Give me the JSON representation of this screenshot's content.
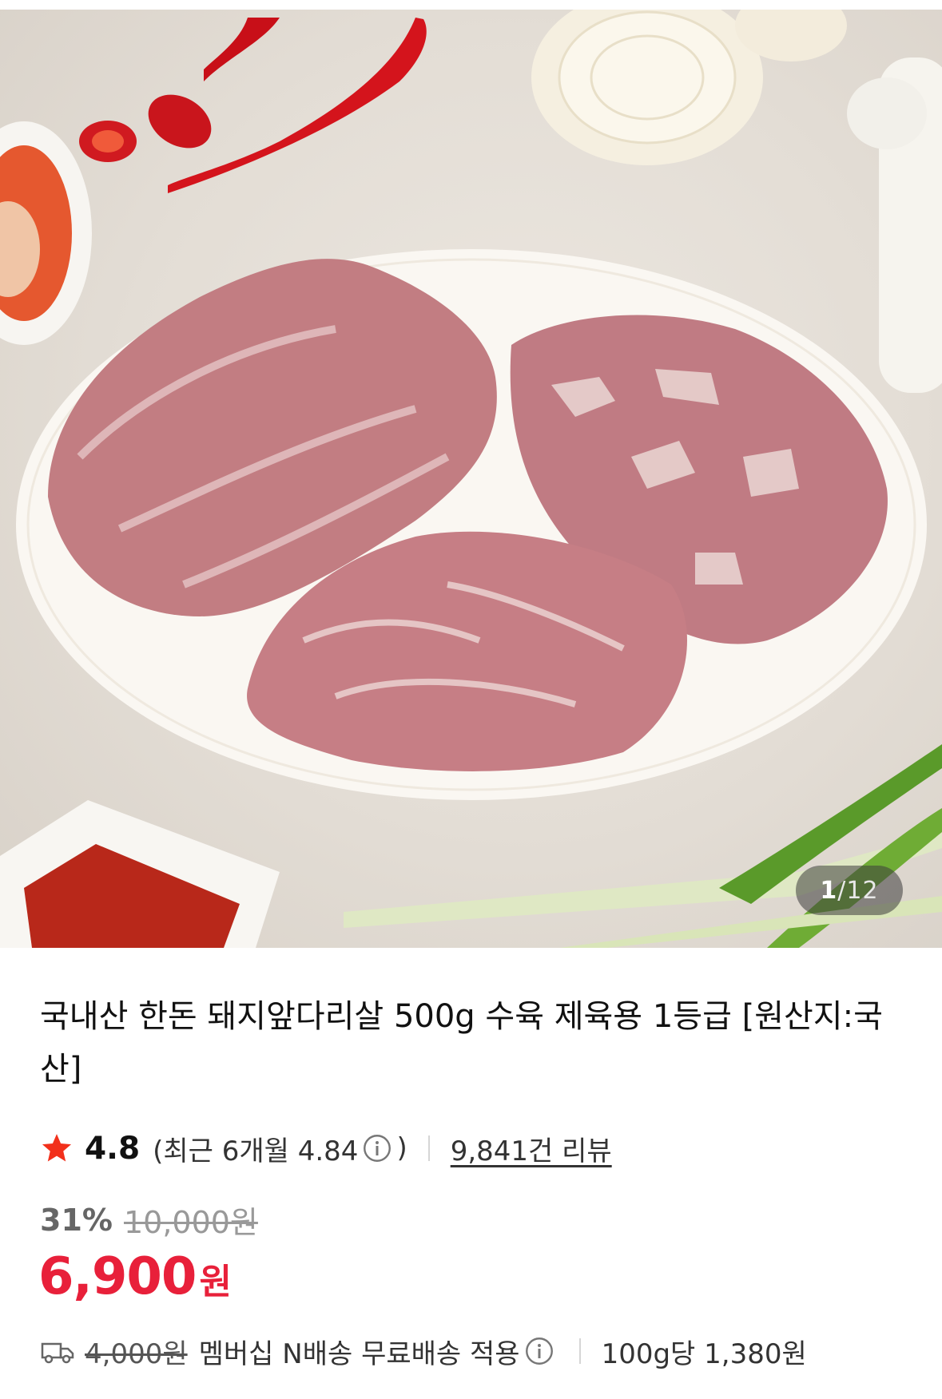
{
  "gallery": {
    "current": "1",
    "separator": "/",
    "total": "12"
  },
  "product": {
    "title": "국내산 한돈 돼지앞다리살 500g 수육 제육용 1등급 [원산지:국산]"
  },
  "rating": {
    "score": "4.8",
    "recent_prefix": "(최근 6개월 4.84",
    "recent_suffix": ")",
    "review_count": "9,841건 리뷰"
  },
  "price": {
    "discount_rate": "31%",
    "original": "10,000원",
    "sale": "6,900",
    "currency": "원"
  },
  "shipping": {
    "original_fee": "4,000원",
    "label": "멤버십 N배송 무료배송 적용",
    "unit_price": "100g당 1,380원"
  },
  "colors": {
    "accent": "#e8203a",
    "star": "#f2301b",
    "text": "#111111",
    "muted": "#999999"
  },
  "icons": [
    "star-icon",
    "info-icon",
    "truck-icon"
  ]
}
